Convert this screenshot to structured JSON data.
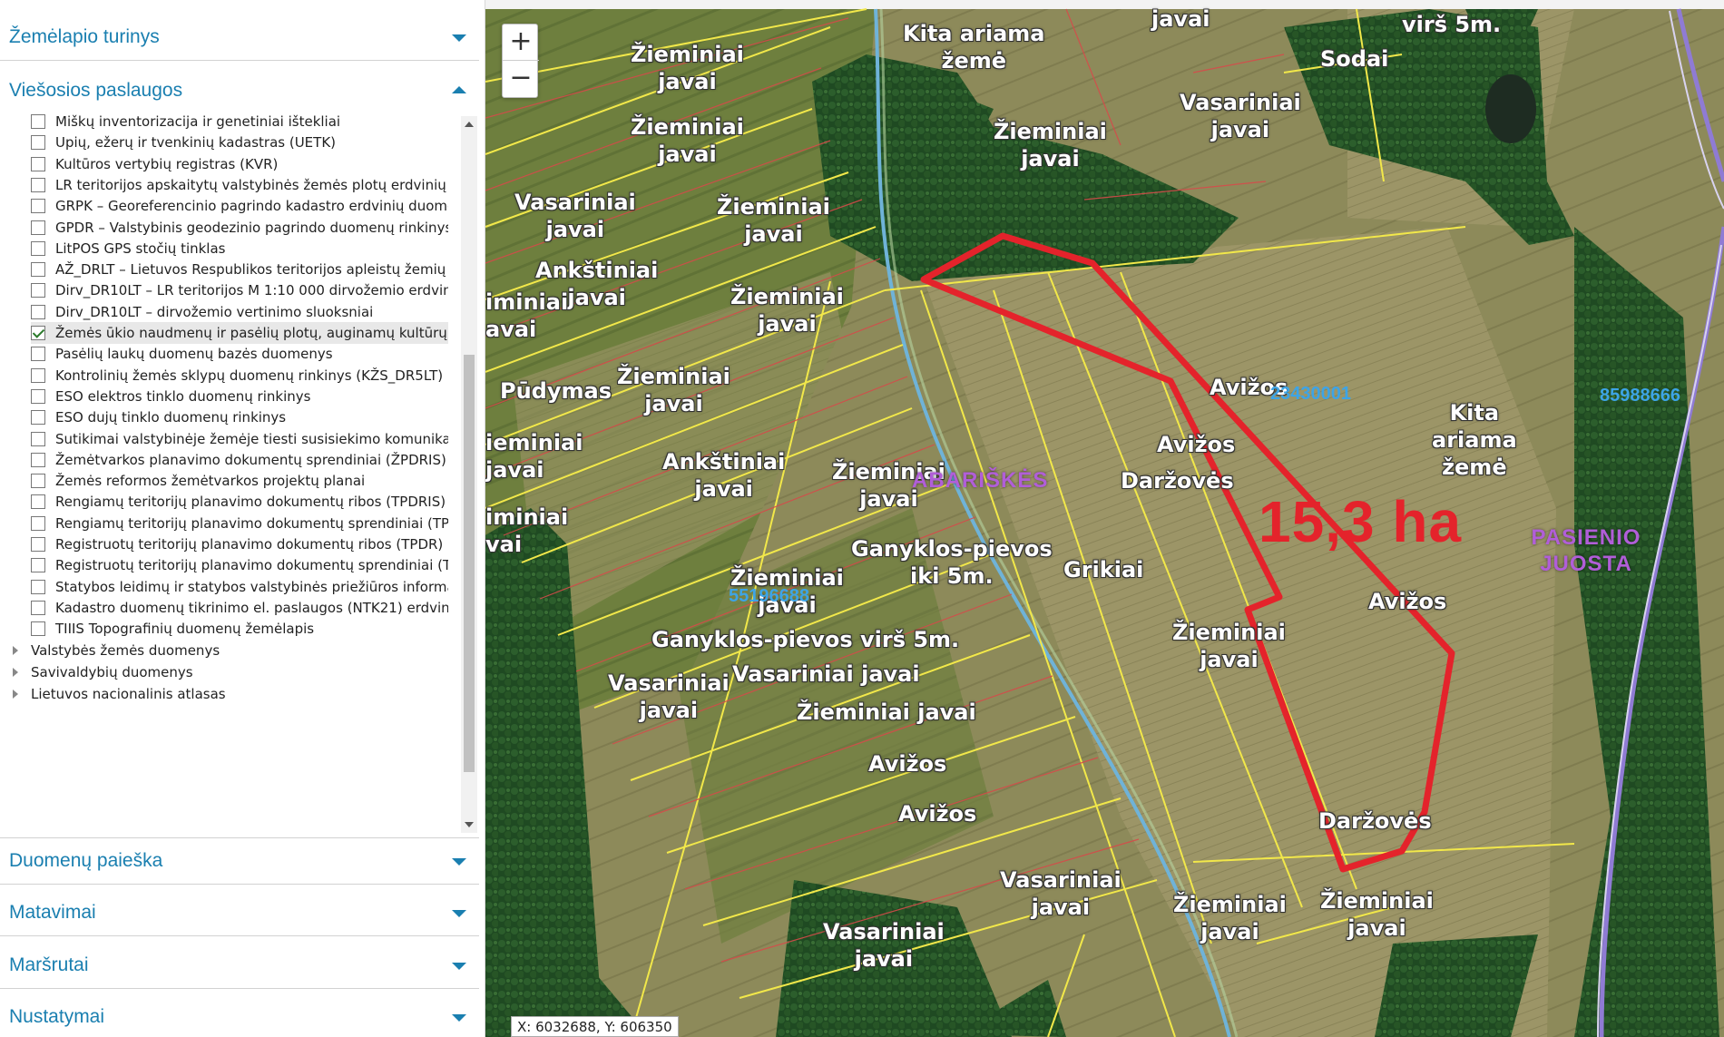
{
  "panel": {
    "sections": {
      "map_content": "Žemėlapio turinys",
      "public_services": "Viešosios paslaugos",
      "data_search": "Duomenų paieška",
      "measurements": "Matavimai",
      "routes": "Maršrutai",
      "settings": "Nustatymai"
    },
    "layers": [
      {
        "label": "Miškų inventorizacija ir genetiniai ištekliai",
        "checked": false
      },
      {
        "label": "Upių, ežerų ir tvenkinių kadastras (UETK)",
        "checked": false
      },
      {
        "label": "Kultūros vertybių registras (KVR)",
        "checked": false
      },
      {
        "label": "LR teritorijos apskaitytų valstybinės žemės plotų erdvinių duo",
        "checked": false
      },
      {
        "label": "GRPK – Georeferencinio pagrindo kadastro erdvinių duomenų",
        "checked": false
      },
      {
        "label": "GPDR – Valstybinis geodezinio pagrindo duomenų rinkinys",
        "checked": false
      },
      {
        "label": "LitPOS GPS stočių tinklas",
        "checked": false
      },
      {
        "label": "AŽ_DRLT – Lietuvos Respublikos teritorijos apleistų žemių erd",
        "checked": false
      },
      {
        "label": "Dirv_DR10LT – LR teritorijos M 1:10 000 dirvožemio erdvinių",
        "checked": false
      },
      {
        "label": "Dirv_DR10LT – dirvožemio vertinimo sluoksniai",
        "checked": false
      },
      {
        "label": "Žemės ūkio naudmenų ir pasėlių plotų, auginamų kultūrų duo",
        "checked": true
      },
      {
        "label": "Pasėlių laukų duomenų bazės duomenys",
        "checked": false
      },
      {
        "label": "Kontrolinių žemės sklypų duomenų rinkinys (KŽS_DR5LT)",
        "checked": false
      },
      {
        "label": "ESO elektros tinklo duomenų rinkinys",
        "checked": false
      },
      {
        "label": "ESO dujų tinklo duomenų rinkinys",
        "checked": false
      },
      {
        "label": "Sutikimai valstybinėje žemėje tiesti susisiekimo komunikacijas",
        "checked": false
      },
      {
        "label": "Žemėtvarkos planavimo dokumentų sprendiniai (ŽPDRIS)",
        "checked": false
      },
      {
        "label": "Žemės reformos žemėtvarkos projektų planai",
        "checked": false
      },
      {
        "label": "Rengiamų teritorijų planavimo dokumentų ribos (TPDRIS)",
        "checked": false
      },
      {
        "label": "Rengiamų teritorijų planavimo dokumentų sprendiniai (TPDRI",
        "checked": false
      },
      {
        "label": "Registruotų teritorijų planavimo dokumentų ribos (TPDR)",
        "checked": false
      },
      {
        "label": "Registruotų teritorijų planavimo dokumentų sprendiniai (TPDI",
        "checked": false
      },
      {
        "label": "Statybos leidimų ir statybos valstybinės priežiūros informacinė",
        "checked": false
      },
      {
        "label": "Kadastro duomenų tikrinimo el. paslaugos (NTK21) erdviniai d",
        "checked": false
      },
      {
        "label": "TIIIS Topografinių duomenų žemėlapis",
        "checked": false
      }
    ],
    "groups": [
      "Valstybės žemės duomenys",
      "Savivaldybių duomenys",
      "Lietuvos nacionalinis atlasas"
    ]
  },
  "map": {
    "zoom_in": "+",
    "zoom_out": "−",
    "area_label": "15,3 ha",
    "coords": "X: 6032688, Y: 606350",
    "parcel_ids": [
      "23430001",
      "85988666",
      "55196688"
    ],
    "place_names": [
      "ABARIŠKĖS",
      "PASIENIO JUOSTA"
    ],
    "labels": {
      "l01": "Žieminiai\njavai",
      "l02": "Žieminiai\njavai",
      "l03": "Vasariniai\njavai",
      "l04": "Žieminiai\njavai",
      "l05": "Ankštiniai\njavai",
      "l06": "Žieminiai\njavai",
      "l07": "Pūdymas",
      "l08": "Žieminiai\njavai",
      "l09": "Žieminiai\njavai",
      "l10": "Ankštiniai\njavai",
      "l11": "Žieminiai\njavai",
      "l12": "Ganyklos-pievos\niki 5m.",
      "l13": "Žieminiai\njavai",
      "l14": "Ganyklos-pievos virš 5m.",
      "l15": "Vasariniai javai",
      "l16": "Vasariniai\njavai",
      "l17": "Žieminiai javai",
      "l18": "Avižos",
      "l19": "Avižos",
      "l20": "Vasariniai\njavai",
      "l21": "Vasariniai\njavai",
      "l22": "Kita ariama\nžemė",
      "l23": "Žieminiai\njavai",
      "l24": "javai",
      "l25": "Sodai",
      "l26": "virš 5m.",
      "l27": "Vasariniai\njavai",
      "l28": "Avižos",
      "l29": "Avižos",
      "l30": "Daržovės",
      "l31": "Grikiai",
      "l32": "Žieminiai\njavai",
      "l33": "Avižos",
      "l34": "Daržovės",
      "l35": "Kita\nariama\nžemė",
      "l36": "Žieminiai\njavai",
      "l37": "Žieminiai\njavai",
      "l38": "iminiai\navai",
      "l39": "ieminiai\njavai",
      "l40": "iminiai\nvai",
      "l41": "Žieminiai\njavai"
    }
  }
}
